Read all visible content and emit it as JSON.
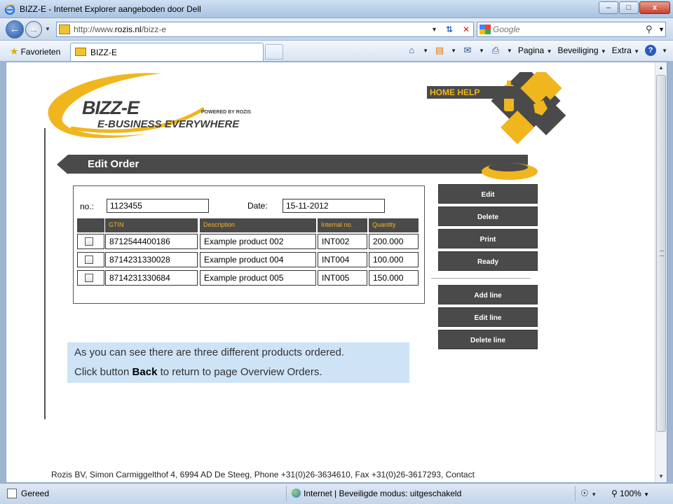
{
  "window": {
    "title": "BIZZ-E - Internet Explorer aangeboden door Dell",
    "minimize": "–",
    "maximize": "□",
    "close": "x"
  },
  "address": {
    "url_prefix": "http://www.",
    "url_domain": "rozis.nl",
    "url_path": "/bizz-e",
    "search_placeholder": "Google"
  },
  "favorites_bar": {
    "favorites_label": "Favorieten",
    "tab_label": "BIZZ-E",
    "menu": [
      "Pagina",
      "Beveiliging",
      "Extra"
    ]
  },
  "logo": {
    "brand": "BIZZ-E",
    "tagline": "E-BUSINESS EVERYWHERE",
    "powered_by": "POWERED BY ROZIS"
  },
  "home_help_label": "HOME HELP",
  "page_title": "Edit Order",
  "order": {
    "no_label": "no.:",
    "no_value": "1123455",
    "date_label": "Date:",
    "date_value": "15-11-2012",
    "columns": [
      "GTIN",
      "Description",
      "Internal no.",
      "Quantity"
    ],
    "rows": [
      {
        "gtin": "8712544400186",
        "description": "Example product 002",
        "internal": "INT002",
        "quantity": "200.000"
      },
      {
        "gtin": "8714231330028",
        "description": "Example product 004",
        "internal": "INT004",
        "quantity": "100.000"
      },
      {
        "gtin": "8714231330684",
        "description": "Example product 005",
        "internal": "INT005",
        "quantity": "150.000"
      }
    ]
  },
  "actions": {
    "edit": "Edit",
    "delete": "Delete",
    "print": "Print",
    "ready": "Ready",
    "add_line": "Add line",
    "edit_line": "Edit line",
    "delete_line": "Delete line"
  },
  "info": {
    "line1": "As you can see there are three different products ordered.",
    "line2_pre": "Click button ",
    "line2_bold": "Back",
    "line2_post": " to return to page Overview Orders."
  },
  "footer": "Rozis BV, Simon Carmiggelthof 4, 6994 AD De Steeg, Phone +31(0)26-3634610, Fax +31(0)26-3617293, Contact",
  "status": {
    "text": "Gereed",
    "zone": "Internet | Beveiligde modus: uitgeschakeld",
    "zoom": "100%"
  },
  "colors": {
    "accent_yellow": "#f0b61e",
    "dark_gray": "#4a4a4a",
    "info_blue": "#cfe3f7"
  }
}
